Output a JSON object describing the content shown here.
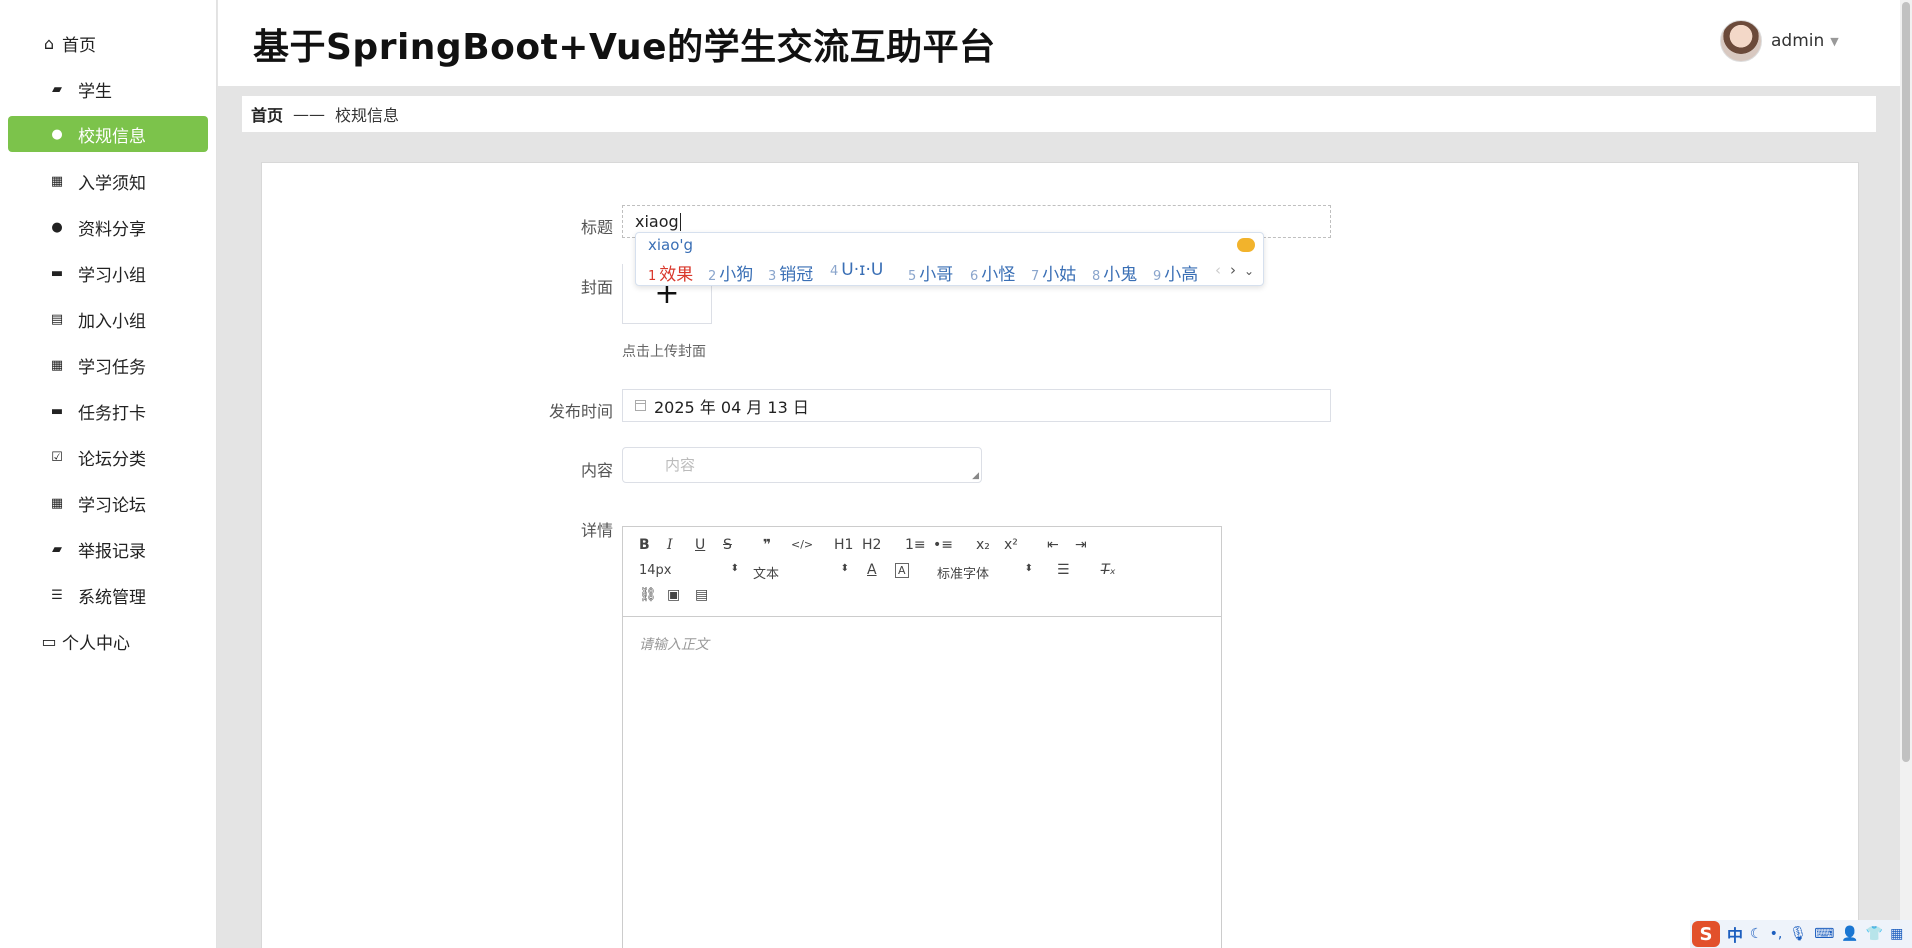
{
  "app": {
    "title": "基于SpringBoot+Vue的学生交流互助平台"
  },
  "user": {
    "name": "admin"
  },
  "sidebar": {
    "items": [
      {
        "label": "首页",
        "icon": "home-icon",
        "glyph": "⌂"
      },
      {
        "label": "学生",
        "icon": "ticket-icon",
        "glyph": "▰"
      },
      {
        "label": "校规信息",
        "icon": "user-icon",
        "glyph": "●"
      },
      {
        "label": "入学须知",
        "icon": "grid-icon",
        "glyph": "▦"
      },
      {
        "label": "资料分享",
        "icon": "bulb-icon",
        "glyph": "●"
      },
      {
        "label": "学习小组",
        "icon": "briefcase-icon",
        "glyph": "▬"
      },
      {
        "label": "加入小组",
        "icon": "clipboard-icon",
        "glyph": "▤"
      },
      {
        "label": "学习任务",
        "icon": "grid-icon",
        "glyph": "▦"
      },
      {
        "label": "任务打卡",
        "icon": "monitor-icon",
        "glyph": "▬"
      },
      {
        "label": "论坛分类",
        "icon": "check-clipboard-icon",
        "glyph": "☑"
      },
      {
        "label": "学习论坛",
        "icon": "grid-icon",
        "glyph": "▦"
      },
      {
        "label": "举报记录",
        "icon": "wallet-icon",
        "glyph": "▰"
      },
      {
        "label": "系统管理",
        "icon": "list-icon",
        "glyph": "☰"
      },
      {
        "label": "个人中心",
        "icon": "id-card-icon",
        "glyph": "▭"
      }
    ]
  },
  "breadcrumb": {
    "home": "首页",
    "separator": "——",
    "current": "校规信息"
  },
  "form": {
    "title_label": "标题",
    "title_value": "xiaog",
    "cover_label": "封面",
    "cover_plus": "+",
    "cover_hint": "点击上传封面",
    "date_label": "发布时间",
    "date_value": "2025 年 04 月 13 日",
    "content_label": "内容",
    "content_placeholder": "内容",
    "detail_label": "详情"
  },
  "editor": {
    "row1": [
      "B",
      "I",
      "U",
      "S",
      "❞",
      "</>",
      "H1",
      "H2",
      "1≡",
      "•≡",
      "x₂",
      "x²",
      "⇤",
      "⇥"
    ],
    "font_size": "14px",
    "block_type": "文本",
    "font_family": "标准字体",
    "placeholder": "请输入正文"
  },
  "ime": {
    "composition": "xiao'g",
    "candidates": [
      {
        "n": "1",
        "text": "效果"
      },
      {
        "n": "2",
        "text": "小狗"
      },
      {
        "n": "3",
        "text": "销冠"
      },
      {
        "n": "4",
        "text": "U·ɪ·U"
      },
      {
        "n": "5",
        "text": "小哥"
      },
      {
        "n": "6",
        "text": "小怪"
      },
      {
        "n": "7",
        "text": "小姑"
      },
      {
        "n": "8",
        "text": "小鬼"
      },
      {
        "n": "9",
        "text": "小高"
      }
    ]
  },
  "tray": {
    "logo": "S",
    "mode": "中"
  },
  "colors": {
    "accent": "#7cc34b",
    "ime_blue": "#3a6fb5",
    "ime_first": "#d9372b"
  }
}
